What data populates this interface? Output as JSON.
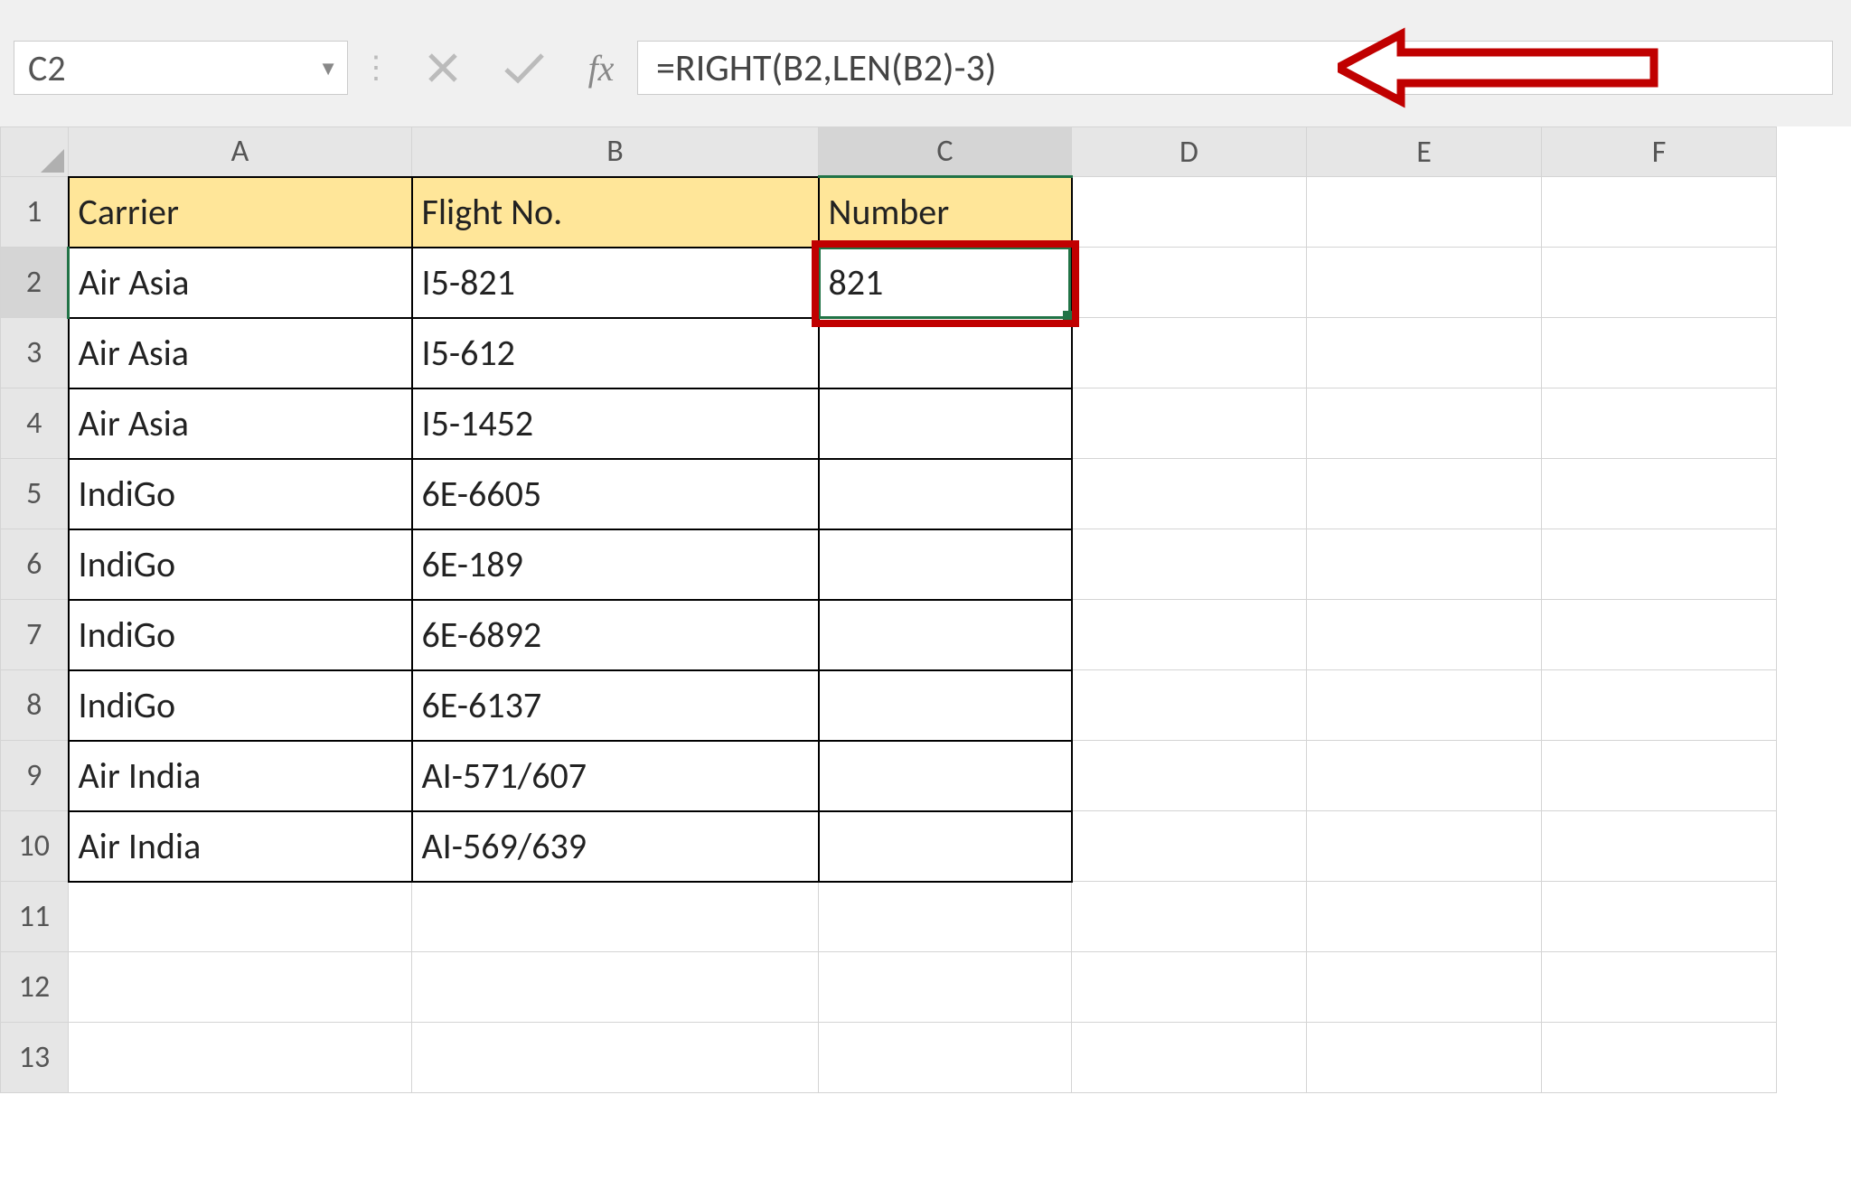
{
  "name_box": "C2",
  "formula": "=RIGHT(B2,LEN(B2)-3)",
  "fx_label": "fx",
  "columns": [
    "A",
    "B",
    "C",
    "D",
    "E",
    "F"
  ],
  "row_numbers": [
    "1",
    "2",
    "3",
    "4",
    "5",
    "6",
    "7",
    "8",
    "9",
    "10",
    "11",
    "12",
    "13"
  ],
  "headers": {
    "A": "Carrier",
    "B": "Flight No.",
    "C": "Number"
  },
  "rows": [
    {
      "A": "Air Asia",
      "B": "I5-821",
      "C": "821"
    },
    {
      "A": "Air Asia",
      "B": "I5-612",
      "C": ""
    },
    {
      "A": "Air Asia",
      "B": "I5-1452",
      "C": ""
    },
    {
      "A": "IndiGo",
      "B": "6E-6605",
      "C": ""
    },
    {
      "A": "IndiGo",
      "B": "6E-189",
      "C": ""
    },
    {
      "A": "IndiGo",
      "B": "6E-6892",
      "C": ""
    },
    {
      "A": "IndiGo",
      "B": "6E-6137",
      "C": ""
    },
    {
      "A": "Air India",
      "B": "AI-571/607",
      "C": ""
    },
    {
      "A": "Air India",
      "B": "AI-569/639",
      "C": ""
    }
  ],
  "selected_cell": "C2",
  "chart_data": {
    "type": "table",
    "title": "",
    "columns": [
      "Carrier",
      "Flight No.",
      "Number"
    ],
    "data": [
      [
        "Air Asia",
        "I5-821",
        "821"
      ],
      [
        "Air Asia",
        "I5-612",
        ""
      ],
      [
        "Air Asia",
        "I5-1452",
        ""
      ],
      [
        "IndiGo",
        "6E-6605",
        ""
      ],
      [
        "IndiGo",
        "6E-189",
        ""
      ],
      [
        "IndiGo",
        "6E-6892",
        ""
      ],
      [
        "IndiGo",
        "6E-6137",
        ""
      ],
      [
        "Air India",
        "AI-571/607",
        ""
      ],
      [
        "Air India",
        "AI-569/639",
        ""
      ]
    ]
  }
}
